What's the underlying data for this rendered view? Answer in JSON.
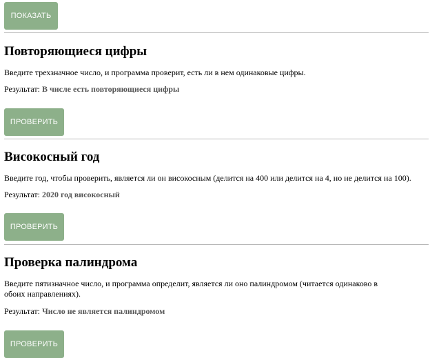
{
  "top_button": {
    "label": "ПОКАЗАТЬ"
  },
  "sections": [
    {
      "title": "Повторяющиеся цифры",
      "description": "Введите трехзначное число, и программа проверит, есть ли в нем одинаковые цифры.",
      "result_label": "Результат:",
      "result_value": "В числе есть повторяющиеся цифры",
      "button_label": "ПРОВЕРИТЬ"
    },
    {
      "title": "Високосный год",
      "description": "Введите год, чтобы проверить, является ли он високосным (делится на 400 или делится на 4, но не делится на 100).",
      "result_label": "Результат:",
      "result_value": "2020 год високосный",
      "button_label": "ПРОВЕРИТЬ"
    },
    {
      "title": "Проверка палиндрома",
      "description": "Введите пятизначное число, и программа определит, является ли оно палиндромом (читается одинаково в обоих направлениях).",
      "result_label": "Результат:",
      "result_value": "Число не является палиндромом",
      "button_label": "ПРОВЕРИТЬ"
    }
  ]
}
